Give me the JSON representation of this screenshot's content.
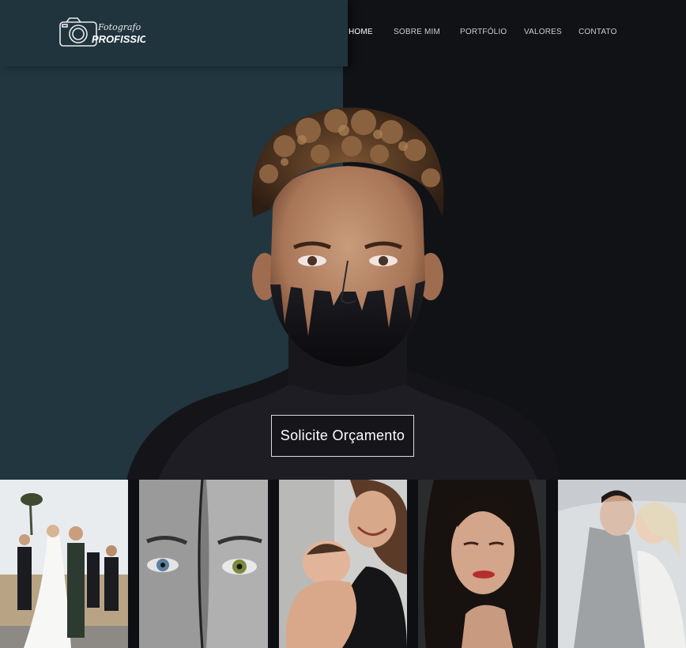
{
  "header": {
    "logo_script": "Fotografo",
    "logo_bold": "PROFISSIONAL",
    "nav": [
      {
        "label": "HOME",
        "active": true
      },
      {
        "label": "SOBRE  MIM",
        "active": false
      },
      {
        "label": "PORTFÓLIO",
        "active": false
      },
      {
        "label": "VALORES",
        "active": false
      },
      {
        "label": "CONTATO",
        "active": false
      }
    ]
  },
  "hero": {
    "cta_label": "Solicite Orçamento",
    "colors": {
      "left_panel": "#21363f",
      "right_panel": "#111216"
    }
  },
  "gallery": {
    "photos": [
      {
        "subject": "wedding-party"
      },
      {
        "subject": "two-faces-eyes"
      },
      {
        "subject": "mother-and-baby"
      },
      {
        "subject": "woman-portrait"
      },
      {
        "subject": "couple-kissing-veil"
      }
    ]
  },
  "icons": {
    "logo": "camera-icon"
  }
}
